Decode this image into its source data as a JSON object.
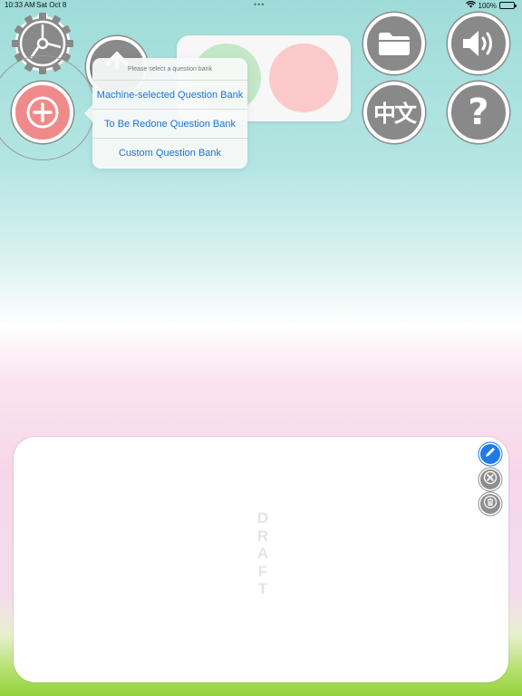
{
  "status_bar": {
    "time": "10:33 AM",
    "date": "Sat Oct 8",
    "multitask_dots": "•••",
    "battery_percent": "100%"
  },
  "toolbar": {
    "icons": [
      "gear-icon",
      "plus-icon",
      "back-icon",
      "folder-icon",
      "speaker-icon",
      "chinese-language-icon",
      "question-mark-icon"
    ],
    "chinese_label": "中文",
    "help_label": "?"
  },
  "popover": {
    "title": "Please select a question bank",
    "items": [
      "Machine-selected Question Bank",
      "To Be Redone Question Bank",
      "Custom Question Bank"
    ]
  },
  "draft_card": {
    "watermark_letters": [
      "D",
      "R",
      "A",
      "F",
      "T"
    ],
    "tools": [
      "pencil-icon",
      "clear-icon",
      "trash-icon"
    ]
  },
  "colors": {
    "accent_blue": "#1f7be8",
    "button_gray": "#898989",
    "add_button_red": "#f08a8a",
    "answer_green": "#c4e7c8",
    "answer_red": "#fbc9c9"
  }
}
